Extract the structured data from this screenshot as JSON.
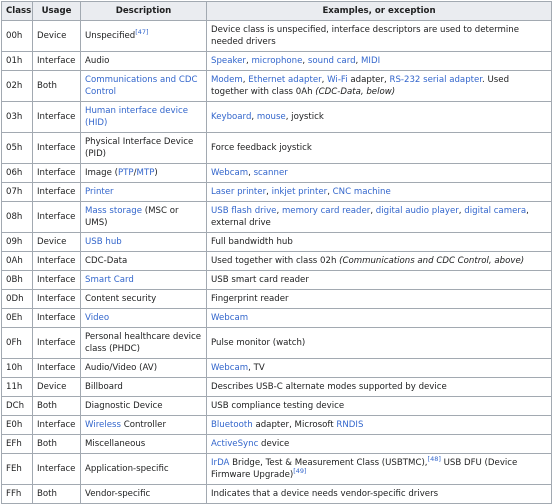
{
  "colors": {
    "link": "#3366cc",
    "header_bg": "#eaecf0",
    "border": "#a2a9b1",
    "text": "#202122"
  },
  "headers": [
    "Class",
    "Usage",
    "Description",
    "Examples, or exception"
  ],
  "rows": [
    {
      "cls": "00h",
      "usage": "Device",
      "desc": [
        {
          "t": "Unspecified"
        },
        {
          "t": "[47]",
          "sup": true,
          "link": true
        }
      ],
      "ex": [
        {
          "t": "Device class is unspecified, interface descriptors are used to determine needed drivers"
        }
      ]
    },
    {
      "cls": "01h",
      "usage": "Interface",
      "desc": [
        {
          "t": "Audio"
        }
      ],
      "ex": [
        {
          "t": "Speaker",
          "link": true
        },
        {
          "t": ", "
        },
        {
          "t": "microphone",
          "link": true
        },
        {
          "t": ", "
        },
        {
          "t": "sound card",
          "link": true
        },
        {
          "t": ", "
        },
        {
          "t": "MIDI",
          "link": true
        }
      ]
    },
    {
      "cls": "02h",
      "usage": "Both",
      "desc": [
        {
          "t": "Communications and CDC Control",
          "link": true
        }
      ],
      "ex": [
        {
          "t": "Modem",
          "link": true
        },
        {
          "t": ", "
        },
        {
          "t": "Ethernet adapter",
          "link": true
        },
        {
          "t": ", "
        },
        {
          "t": "Wi-Fi",
          "link": true
        },
        {
          "t": " adapter, "
        },
        {
          "t": "RS-232 serial adapter",
          "link": true
        },
        {
          "t": ". Used together with class 0Ah "
        },
        {
          "t": "(CDC-Data, below)",
          "i": true
        }
      ]
    },
    {
      "cls": "03h",
      "usage": "Interface",
      "desc": [
        {
          "t": "Human interface device (HID)",
          "link": true
        }
      ],
      "ex": [
        {
          "t": "Keyboard",
          "link": true
        },
        {
          "t": ", "
        },
        {
          "t": "mouse",
          "link": true
        },
        {
          "t": ", joystick"
        }
      ]
    },
    {
      "cls": "05h",
      "usage": "Interface",
      "desc": [
        {
          "t": "Physical Interface Device (PID)"
        }
      ],
      "ex": [
        {
          "t": "Force feedback joystick"
        }
      ]
    },
    {
      "cls": "06h",
      "usage": "Interface",
      "desc": [
        {
          "t": "Image ("
        },
        {
          "t": "PTP",
          "link": true
        },
        {
          "t": "/"
        },
        {
          "t": "MTP",
          "link": true
        },
        {
          "t": ")"
        }
      ],
      "ex": [
        {
          "t": "Webcam",
          "link": true
        },
        {
          "t": ", "
        },
        {
          "t": "scanner",
          "link": true
        }
      ]
    },
    {
      "cls": "07h",
      "usage": "Interface",
      "desc": [
        {
          "t": "Printer",
          "link": true
        }
      ],
      "ex": [
        {
          "t": "Laser printer",
          "link": true
        },
        {
          "t": ", "
        },
        {
          "t": "inkjet printer",
          "link": true
        },
        {
          "t": ", "
        },
        {
          "t": "CNC machine",
          "link": true
        }
      ]
    },
    {
      "cls": "08h",
      "usage": "Interface",
      "desc": [
        {
          "t": "Mass storage",
          "link": true
        },
        {
          "t": " (MSC or UMS)"
        }
      ],
      "ex": [
        {
          "t": "USB flash drive",
          "link": true
        },
        {
          "t": ", "
        },
        {
          "t": "memory card reader",
          "link": true
        },
        {
          "t": ", "
        },
        {
          "t": "digital audio player",
          "link": true
        },
        {
          "t": ", "
        },
        {
          "t": "digital camera",
          "link": true
        },
        {
          "t": ", external drive"
        }
      ]
    },
    {
      "cls": "09h",
      "usage": "Device",
      "desc": [
        {
          "t": "USB hub",
          "link": true
        }
      ],
      "ex": [
        {
          "t": "Full bandwidth hub"
        }
      ]
    },
    {
      "cls": "0Ah",
      "usage": "Interface",
      "desc": [
        {
          "t": "CDC-Data"
        }
      ],
      "ex": [
        {
          "t": "Used together with class 02h "
        },
        {
          "t": "(Communications and CDC Control, above)",
          "i": true
        }
      ]
    },
    {
      "cls": "0Bh",
      "usage": "Interface",
      "desc": [
        {
          "t": "Smart Card",
          "link": true
        }
      ],
      "ex": [
        {
          "t": "USB smart card reader"
        }
      ]
    },
    {
      "cls": "0Dh",
      "usage": "Interface",
      "desc": [
        {
          "t": "Content security"
        }
      ],
      "ex": [
        {
          "t": "Fingerprint reader"
        }
      ]
    },
    {
      "cls": "0Eh",
      "usage": "Interface",
      "desc": [
        {
          "t": "Video",
          "link": true
        }
      ],
      "ex": [
        {
          "t": "Webcam",
          "link": true
        }
      ]
    },
    {
      "cls": "0Fh",
      "usage": "Interface",
      "desc": [
        {
          "t": "Personal healthcare device class (PHDC)"
        }
      ],
      "ex": [
        {
          "t": "Pulse monitor (watch)"
        }
      ]
    },
    {
      "cls": "10h",
      "usage": "Interface",
      "desc": [
        {
          "t": "Audio/Video (AV)"
        }
      ],
      "ex": [
        {
          "t": "Webcam",
          "link": true
        },
        {
          "t": ", TV"
        }
      ]
    },
    {
      "cls": "11h",
      "usage": "Device",
      "desc": [
        {
          "t": "Billboard"
        }
      ],
      "ex": [
        {
          "t": "Describes USB-C alternate modes supported by device"
        }
      ]
    },
    {
      "cls": "DCh",
      "usage": "Both",
      "desc": [
        {
          "t": "Diagnostic Device"
        }
      ],
      "ex": [
        {
          "t": "USB compliance testing device"
        }
      ]
    },
    {
      "cls": "E0h",
      "usage": "Interface",
      "desc": [
        {
          "t": "Wireless",
          "link": true
        },
        {
          "t": " Controller"
        }
      ],
      "ex": [
        {
          "t": "Bluetooth",
          "link": true
        },
        {
          "t": " adapter, Microsoft "
        },
        {
          "t": "RNDIS",
          "link": true
        }
      ]
    },
    {
      "cls": "EFh",
      "usage": "Both",
      "desc": [
        {
          "t": "Miscellaneous"
        }
      ],
      "ex": [
        {
          "t": "ActiveSync",
          "link": true
        },
        {
          "t": " device"
        }
      ]
    },
    {
      "cls": "FEh",
      "usage": "Interface",
      "desc": [
        {
          "t": "Application-specific"
        }
      ],
      "ex": [
        {
          "t": "IrDA",
          "link": true
        },
        {
          "t": " Bridge, Test & Measurement Class (USBTMC),"
        },
        {
          "t": "[48]",
          "sup": true,
          "link": true
        },
        {
          "t": " USB DFU (Device Firmware Upgrade)"
        },
        {
          "t": "[49]",
          "sup": true,
          "link": true
        }
      ]
    },
    {
      "cls": "FFh",
      "usage": "Both",
      "desc": [
        {
          "t": "Vendor-specific"
        }
      ],
      "ex": [
        {
          "t": "Indicates that a device needs vendor-specific drivers"
        }
      ]
    }
  ]
}
